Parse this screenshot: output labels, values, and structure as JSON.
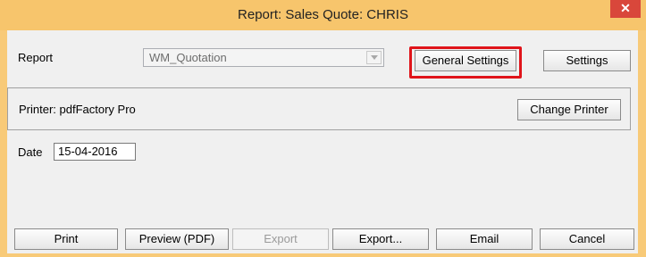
{
  "window": {
    "title": "Report: Sales Quote: CHRIS",
    "close_glyph": "✕"
  },
  "report": {
    "label": "Report",
    "selected": "WM_Quotation",
    "general_settings_label": "General Settings",
    "settings_label": "Settings"
  },
  "printer": {
    "label": "Printer: pdfFactory Pro",
    "change_label": "Change Printer"
  },
  "date": {
    "label": "Date",
    "value": "15-04-2016"
  },
  "footer": {
    "print_label": "Print",
    "preview_label": "Preview (PDF)",
    "export_disabled_label": "Export",
    "export_label": "Export...",
    "email_label": "Email",
    "cancel_label": "Cancel"
  },
  "colors": {
    "titlebar": "#f7c56c",
    "highlight": "#e0141a",
    "close": "#d9473b"
  }
}
